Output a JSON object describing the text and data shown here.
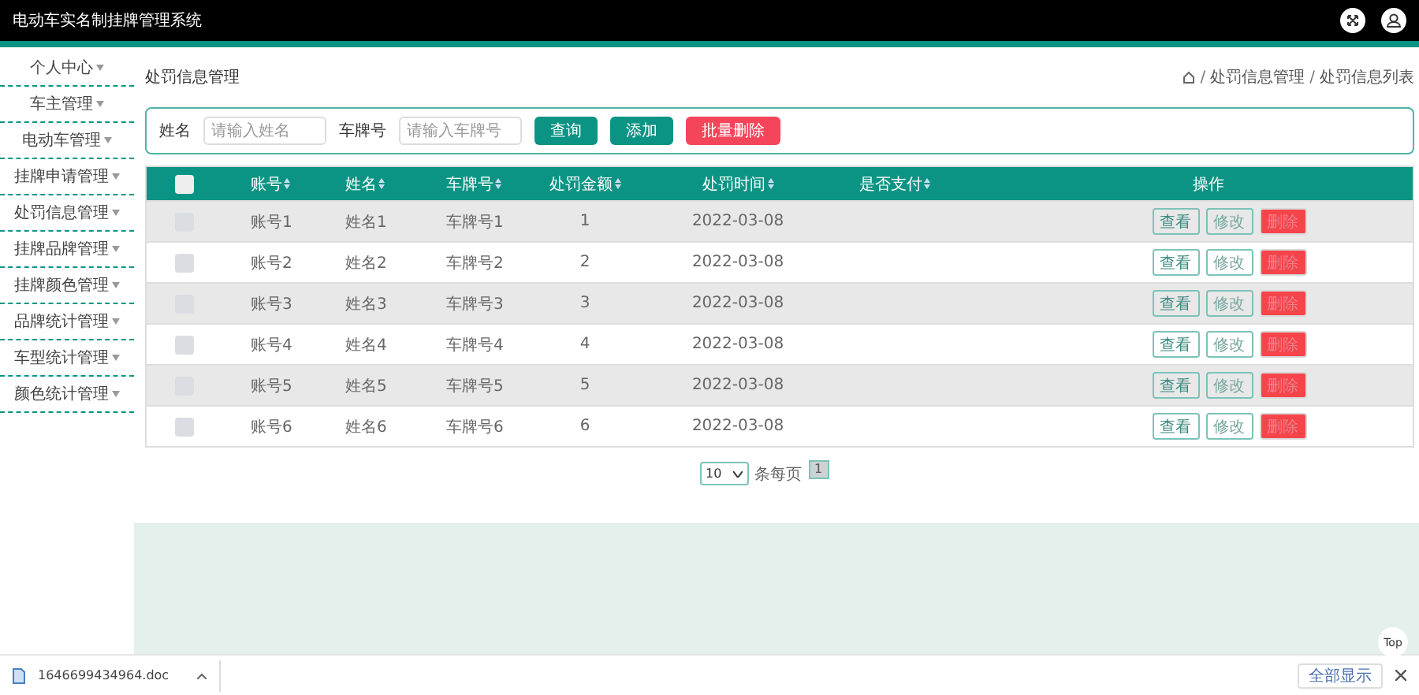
{
  "header": {
    "title": "电动车实名制挂牌管理系统"
  },
  "sidebar": {
    "items": [
      {
        "label": "个人中心"
      },
      {
        "label": "车主管理"
      },
      {
        "label": "电动车管理"
      },
      {
        "label": "挂牌申请管理"
      },
      {
        "label": "处罚信息管理"
      },
      {
        "label": "挂牌品牌管理"
      },
      {
        "label": "挂牌颜色管理"
      },
      {
        "label": "品牌统计管理"
      },
      {
        "label": "车型统计管理"
      },
      {
        "label": "颜色统计管理"
      }
    ]
  },
  "page": {
    "title": "处罚信息管理",
    "breadcrumb": [
      {
        "separator": "/",
        "label": "处罚信息管理"
      },
      {
        "separator": "/",
        "label": "处罚信息列表"
      }
    ]
  },
  "search": {
    "fields": [
      {
        "label": "姓名",
        "placeholder": "请输入姓名"
      },
      {
        "label": "车牌号",
        "placeholder": "请输入车牌号"
      }
    ],
    "buttons": [
      {
        "label": "查询",
        "kind": "primary"
      },
      {
        "label": "添加",
        "kind": "primary"
      },
      {
        "label": "批量删除",
        "kind": "danger"
      }
    ]
  },
  "table": {
    "select_all": {
      "checked": false
    },
    "columns": [
      {
        "label": "账号",
        "sortable": true
      },
      {
        "label": "姓名",
        "sortable": true
      },
      {
        "label": "车牌号",
        "sortable": true
      },
      {
        "label": "处罚金额",
        "sortable": true
      },
      {
        "label": "处罚时间",
        "sortable": true
      },
      {
        "label": "是否支付",
        "sortable": true
      },
      {
        "label": "操作",
        "sortable": false
      }
    ],
    "rows": [
      {
        "checked": false,
        "cells": [
          "账号1",
          "姓名1",
          "车牌号1",
          "1",
          "2022-03-08"
        ],
        "actions": [
          {
            "label": "查看",
            "kind": "view"
          },
          {
            "label": "修改",
            "kind": "edit"
          },
          {
            "label": "删除",
            "kind": "delete"
          }
        ]
      },
      {
        "checked": false,
        "cells": [
          "账号2",
          "姓名2",
          "车牌号2",
          "2",
          "2022-03-08"
        ],
        "actions": [
          {
            "label": "查看",
            "kind": "view"
          },
          {
            "label": "修改",
            "kind": "edit"
          },
          {
            "label": "删除",
            "kind": "delete"
          }
        ]
      },
      {
        "checked": false,
        "cells": [
          "账号3",
          "姓名3",
          "车牌号3",
          "3",
          "2022-03-08"
        ],
        "actions": [
          {
            "label": "查看",
            "kind": "view"
          },
          {
            "label": "修改",
            "kind": "edit"
          },
          {
            "label": "删除",
            "kind": "delete"
          }
        ]
      },
      {
        "checked": false,
        "cells": [
          "账号4",
          "姓名4",
          "车牌号4",
          "4",
          "2022-03-08"
        ],
        "actions": [
          {
            "label": "查看",
            "kind": "view"
          },
          {
            "label": "修改",
            "kind": "edit"
          },
          {
            "label": "删除",
            "kind": "delete"
          }
        ]
      },
      {
        "checked": false,
        "cells": [
          "账号5",
          "姓名5",
          "车牌号5",
          "5",
          "2022-03-08"
        ],
        "actions": [
          {
            "label": "查看",
            "kind": "view"
          },
          {
            "label": "修改",
            "kind": "edit"
          },
          {
            "label": "删除",
            "kind": "delete"
          }
        ]
      },
      {
        "checked": false,
        "cells": [
          "账号6",
          "姓名6",
          "车牌号6",
          "6",
          "2022-03-08"
        ],
        "actions": [
          {
            "label": "查看",
            "kind": "view"
          },
          {
            "label": "修改",
            "kind": "edit"
          },
          {
            "label": "删除",
            "kind": "delete"
          }
        ]
      }
    ]
  },
  "pagination": {
    "page_size": "10",
    "per_page_label": "条每页",
    "pages": [
      {
        "label": "1",
        "selected": true
      }
    ]
  },
  "back_to_top": "Top",
  "downloads": {
    "file": "1646699434964.doc",
    "show_all": "全部显示"
  }
}
